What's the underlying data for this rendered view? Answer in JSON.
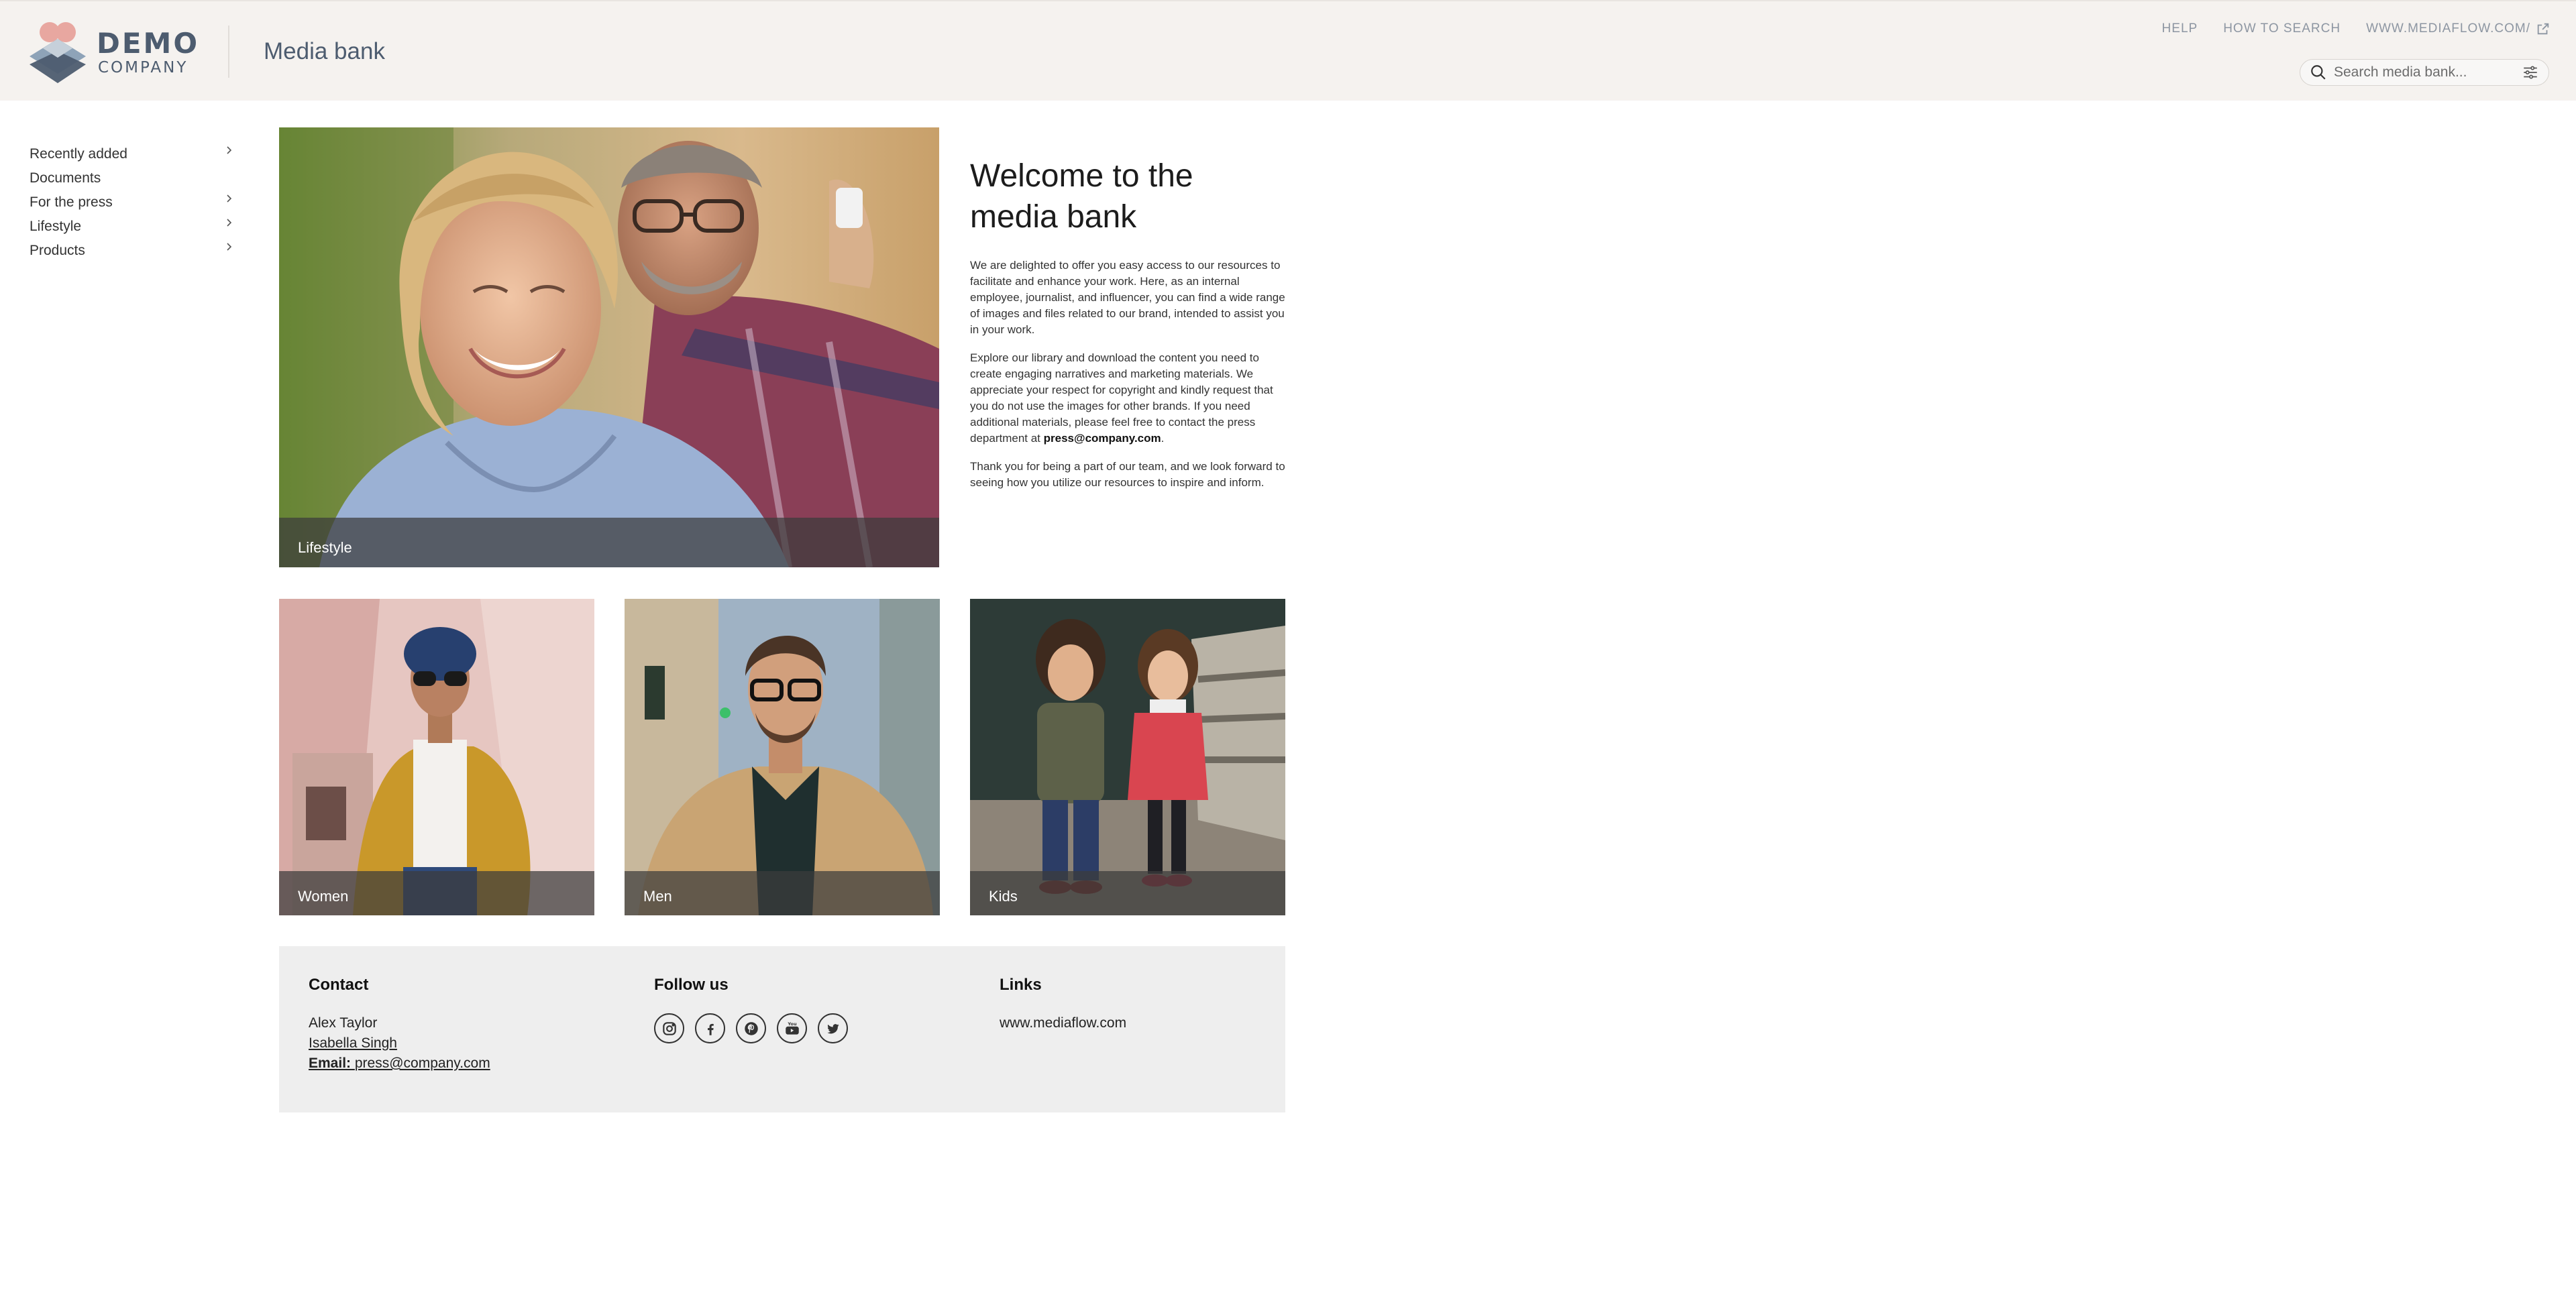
{
  "brand": {
    "line1": "DEMO",
    "line2": "COMPANY"
  },
  "header": {
    "title": "Media bank",
    "links": [
      {
        "label": "HELP"
      },
      {
        "label": "HOW TO SEARCH"
      },
      {
        "label": "WWW.MEDIAFLOW.COM/",
        "icon": "external-link-icon"
      }
    ],
    "search": {
      "placeholder": "Search media bank...",
      "value": ""
    }
  },
  "sidebar": {
    "items": [
      {
        "label": "Recently added",
        "has_children": true
      },
      {
        "label": "Documents",
        "has_children": false
      },
      {
        "label": "For the press",
        "has_children": true
      },
      {
        "label": "Lifestyle",
        "has_children": true
      },
      {
        "label": "Products",
        "has_children": true
      }
    ]
  },
  "hero": {
    "caption": "Lifestyle"
  },
  "welcome": {
    "title": "Welcome to the media bank",
    "paragraphs": [
      "We are delighted to offer you easy access to our resources to facilitate and enhance your work. Here, as an internal employee, journalist, and influencer, you can find a wide range of images and files related to our brand, intended to assist you in your work.",
      "Explore our library and download the content you need to create engaging narratives and marketing materials. We appreciate your respect for copyright and kindly request that you do not use the images for other brands. If you need additional materials, please feel free to contact the press department at",
      "Thank you for being a part of our team, and we look forward to seeing how you utilize our resources to inspire and inform."
    ],
    "email": "press@company.com",
    "email_suffix": "."
  },
  "tiles": [
    {
      "caption": "Women"
    },
    {
      "caption": "Men"
    },
    {
      "caption": "Kids"
    }
  ],
  "footer": {
    "contact": {
      "heading": "Contact",
      "name1": "Alex Taylor",
      "name2": "Isabella Singh",
      "email_label": "Email:",
      "email": "press@company.com"
    },
    "follow": {
      "heading": "Follow us",
      "icons": [
        "instagram-icon",
        "facebook-icon",
        "pinterest-icon",
        "youtube-icon",
        "twitter-icon"
      ]
    },
    "links": {
      "heading": "Links",
      "items": [
        "www.mediaflow.com"
      ]
    }
  },
  "colors": {
    "header_bg": "#f5f2ef",
    "brand_slate": "#4d5c6f",
    "brand_pink": "#e8a7a0",
    "footer_bg": "#eeeeee"
  }
}
